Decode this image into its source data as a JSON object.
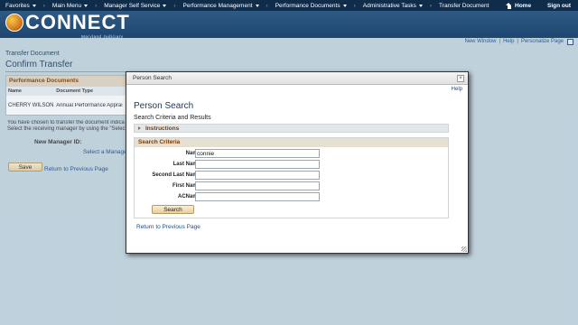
{
  "nav": {
    "items": [
      {
        "label": "Favorites",
        "has_menu": true
      },
      {
        "label": "Main Menu",
        "has_menu": true
      },
      {
        "label": "Manager Self Service",
        "has_menu": true
      },
      {
        "label": "Performance Management",
        "has_menu": true
      },
      {
        "label": "Performance Documents",
        "has_menu": true
      },
      {
        "label": "Administrative Tasks",
        "has_menu": true
      },
      {
        "label": "Transfer Document",
        "has_menu": false
      }
    ],
    "home": "Home",
    "signout": "Sign out"
  },
  "banner": {
    "logo_text": "CONNECT",
    "logo_sub": "Maryland Judiciary"
  },
  "pagebar": {
    "new_window": "New Window",
    "help": "Help",
    "personalize": "Personalize Page"
  },
  "page": {
    "breadcrumb": "Transfer Document",
    "title": "Confirm Transfer",
    "grid": {
      "header": "Performance Documents",
      "columns": [
        "Name",
        "Document Type"
      ],
      "row": [
        "CHERRY WILSON",
        "Annual Performance Apprai"
      ]
    },
    "message_line1": "You have chosen to transfer the document indica",
    "message_line2": "Select the receiving manager by using the \"Select",
    "new_manager_label": "New Manager ID:",
    "select_manager_link": "Select a Manager",
    "save_button": "Save",
    "return_link": "Return to Previous Page"
  },
  "modal": {
    "title": "Person Search",
    "close": "×",
    "help": "Help",
    "heading": "Person Search",
    "subheading": "Search Criteria and Results",
    "instructions": "Instructions",
    "criteria_header": "Search Criteria",
    "fields": {
      "name": {
        "label": "Name",
        "value": "connie"
      },
      "last_name": {
        "label": "Last Name",
        "value": ""
      },
      "second_last_name": {
        "label": "Second Last Name",
        "value": ""
      },
      "first_name": {
        "label": "First Name",
        "value": ""
      },
      "acname": {
        "label": "ACName",
        "value": ""
      }
    },
    "search_button": "Search",
    "return_link": "Return to Previous Page"
  },
  "colors": {
    "nav_bg": "#0f2c4a",
    "banner_bg": "#1d4670",
    "page_bg": "#c5d6e0",
    "link": "#1c4d88",
    "section_header_text": "#7a3b00",
    "button_bg": "#e7cf9e"
  }
}
